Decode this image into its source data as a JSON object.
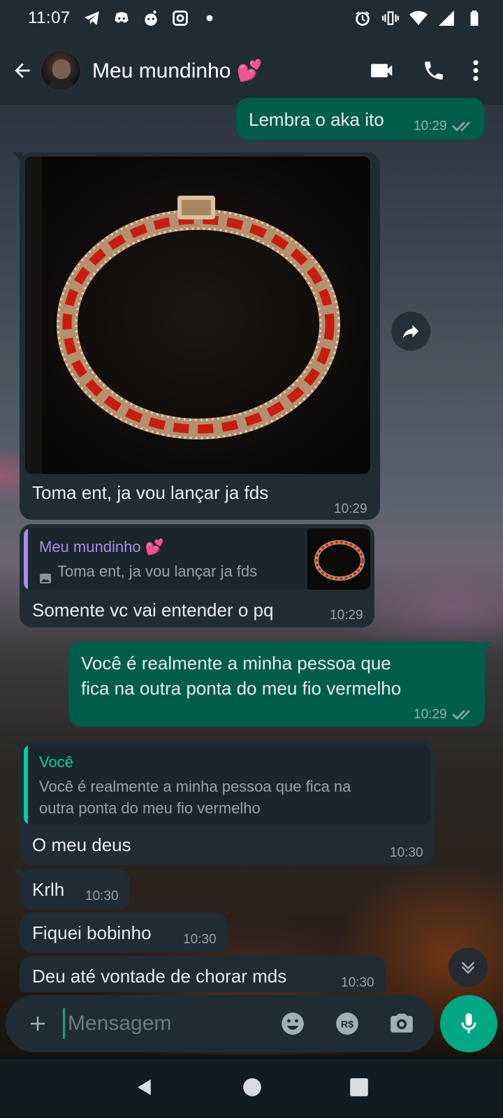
{
  "status_bar": {
    "time": "11:07",
    "left_icons": [
      "telegram-icon",
      "discord-icon",
      "reddit-icon",
      "instagram-icon",
      "dot-icon"
    ],
    "right_icons": [
      "alarm-icon",
      "vibrate-icon",
      "wifi-icon",
      "signal-icon",
      "battery-icon"
    ]
  },
  "header": {
    "contact_name": "Meu mundinho 💕",
    "actions": [
      "video-call-icon",
      "voice-call-icon",
      "more-vert-icon"
    ]
  },
  "messages": [
    {
      "id": "m1",
      "direction": "out",
      "text": "Lembra o aka ito",
      "time": "10:29",
      "status": "read"
    },
    {
      "id": "m2",
      "direction": "in",
      "type": "image",
      "caption": "Toma ent, ja vou lançar ja fds",
      "time": "10:29"
    },
    {
      "id": "m3",
      "direction": "in",
      "quote_author": "Meu mundinho 💕",
      "quote_text": "Toma ent, ja vou lançar ja fds",
      "text": "Somente vc vai entender o pq",
      "time": "10:29"
    },
    {
      "id": "m4",
      "direction": "out",
      "text_line1": "Você é realmente a minha pessoa que",
      "text_line2": "fica na outra ponta do meu fio vermelho",
      "time": "10:29",
      "status": "read"
    },
    {
      "id": "m5",
      "direction": "in",
      "quote_author": "Você",
      "quote_line1": "Você é realmente a minha pessoa que fica na",
      "quote_line2": "outra ponta do meu fio vermelho",
      "text": "O meu deus",
      "time": "10:30"
    },
    {
      "id": "m6",
      "direction": "in",
      "text": "Krlh",
      "time": "10:30"
    },
    {
      "id": "m7",
      "direction": "in",
      "text": "Fiquei bobinho",
      "time": "10:30"
    },
    {
      "id": "m8",
      "direction": "in",
      "text": "Deu até vontade de chorar mds",
      "time": "10:30"
    }
  ],
  "composer": {
    "placeholder": "Mensagem",
    "value": "",
    "icons": [
      "plus-icon",
      "emoji-icon",
      "payment-icon",
      "camera-icon",
      "mic-icon"
    ]
  },
  "colors": {
    "header_bg": "#1f2c34",
    "incoming_bubble": "#1f2c34",
    "outgoing_bubble": "#005c4b",
    "accent": "#00a884",
    "quote_purple": "#a98ce8",
    "quote_green": "#06cf9c"
  }
}
